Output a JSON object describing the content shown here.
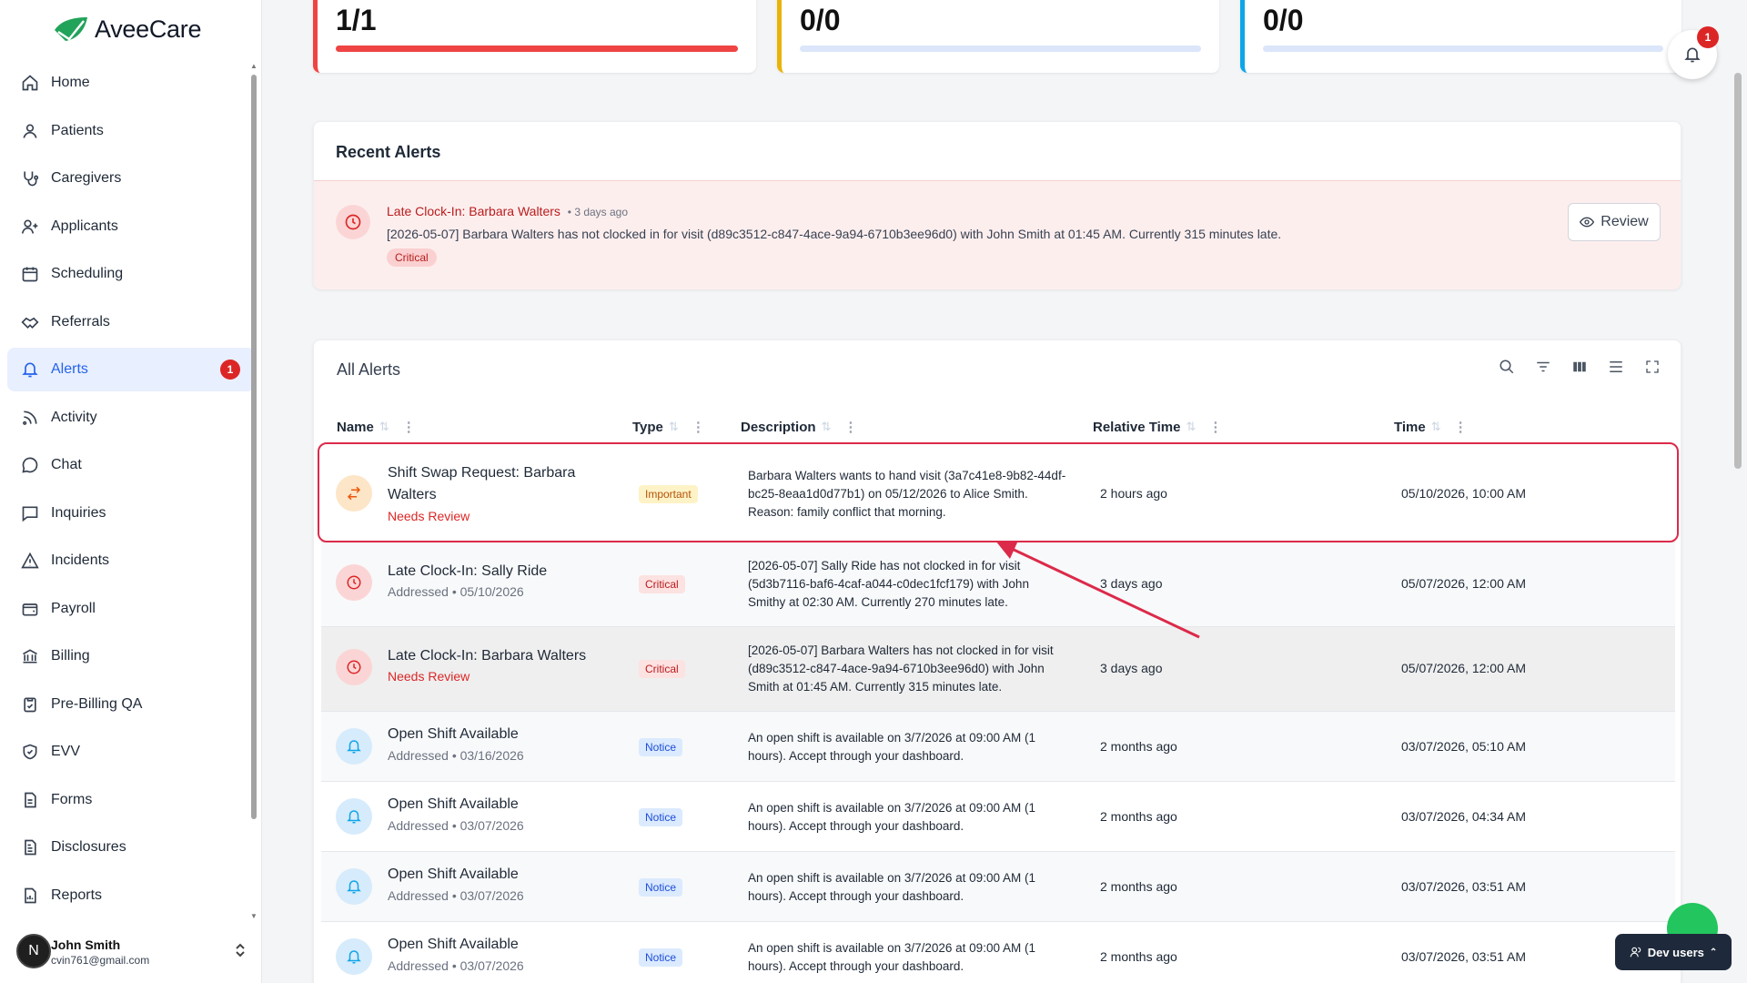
{
  "app": {
    "name": "AveeCare"
  },
  "sidebar": {
    "items": [
      {
        "label": "Home",
        "icon": "home-icon"
      },
      {
        "label": "Patients",
        "icon": "user-icon"
      },
      {
        "label": "Caregivers",
        "icon": "stethoscope-icon"
      },
      {
        "label": "Applicants",
        "icon": "user-plus-icon"
      },
      {
        "label": "Scheduling",
        "icon": "calendar-icon"
      },
      {
        "label": "Referrals",
        "icon": "handshake-icon"
      },
      {
        "label": "Alerts",
        "icon": "bell-icon",
        "active": true,
        "badge": "1"
      },
      {
        "label": "Activity",
        "icon": "rss-icon"
      },
      {
        "label": "Chat",
        "icon": "chat-icon"
      },
      {
        "label": "Inquiries",
        "icon": "message-square-icon"
      },
      {
        "label": "Incidents",
        "icon": "warning-icon"
      },
      {
        "label": "Payroll",
        "icon": "wallet-icon"
      },
      {
        "label": "Billing",
        "icon": "bank-icon"
      },
      {
        "label": "Pre-Billing QA",
        "icon": "clipboard-check-icon"
      },
      {
        "label": "EVV",
        "icon": "shield-check-icon"
      },
      {
        "label": "Forms",
        "icon": "file-icon"
      },
      {
        "label": "Disclosures",
        "icon": "file-text-icon"
      },
      {
        "label": "Reports",
        "icon": "report-icon"
      }
    ],
    "user": {
      "initial": "N",
      "name": "John Smith",
      "email": "cvin761@gmail.com"
    }
  },
  "stats": [
    {
      "value": "1/1",
      "color": "#ef4444",
      "progress": 1.0
    },
    {
      "value": "0/0",
      "color": "#eab308",
      "progress": 0
    },
    {
      "value": "0/0",
      "color": "#0ea5e9",
      "progress": 0
    }
  ],
  "notifications": {
    "badge": "1"
  },
  "recent_alerts": {
    "title": "Recent Alerts",
    "alert": {
      "title": "Late Clock-In: Barbara Walters",
      "meta": "• 3 days ago",
      "description": "[2026-05-07] Barbara Walters has not clocked in for visit (d89c3512-c847-4ace-9a94-6710b3ee96d0) with John Smith at 01:45 AM. Currently 315 minutes late.",
      "badge": "Critical"
    },
    "review_label": "Review"
  },
  "all_alerts": {
    "title": "All Alerts",
    "columns": [
      "Name",
      "Type",
      "Description",
      "Relative Time",
      "Time"
    ],
    "rows": [
      {
        "name": "Shift Swap Request: Barbara Walters",
        "sub": "Needs Review",
        "type": "Important",
        "description": "Barbara Walters wants to hand visit (3a7c41e8-9b82-44df-bc25-8eaa1d0d77b1) on 05/12/2026 to Alice Smith. Reason: family conflict that morning.",
        "relative": "2 hours ago",
        "time": "05/10/2026, 10:00 AM"
      },
      {
        "name": "Late Clock-In: Sally Ride",
        "sub": "Addressed • 05/10/2026",
        "type": "Critical",
        "description": "[2026-05-07] Sally Ride has not clocked in for visit (5d3b7116-baf6-4caf-a044-c0dec1fcf179) with John Smithy at 02:30 AM. Currently 270 minutes late.",
        "relative": "3 days ago",
        "time": "05/07/2026, 12:00 AM"
      },
      {
        "name": "Late Clock-In: Barbara Walters",
        "sub": "Needs Review",
        "type": "Critical",
        "description": "[2026-05-07] Barbara Walters has not clocked in for visit (d89c3512-c847-4ace-9a94-6710b3ee96d0) with John Smith at 01:45 AM. Currently 315 minutes late.",
        "relative": "3 days ago",
        "time": "05/07/2026, 12:00 AM"
      },
      {
        "name": "Open Shift Available",
        "sub": "Addressed • 03/16/2026",
        "type": "Notice",
        "description": "An open shift is available on 3/7/2026 at 09:00 AM (1 hours). Accept through your dashboard.",
        "relative": "2 months ago",
        "time": "03/07/2026, 05:10 AM"
      },
      {
        "name": "Open Shift Available",
        "sub": "Addressed • 03/07/2026",
        "type": "Notice",
        "description": "An open shift is available on 3/7/2026 at 09:00 AM (1 hours). Accept through your dashboard.",
        "relative": "2 months ago",
        "time": "03/07/2026, 04:34 AM"
      },
      {
        "name": "Open Shift Available",
        "sub": "Addressed • 03/07/2026",
        "type": "Notice",
        "description": "An open shift is available on 3/7/2026 at 09:00 AM (1 hours). Accept through your dashboard.",
        "relative": "2 months ago",
        "time": "03/07/2026, 03:51 AM"
      },
      {
        "name": "Open Shift Available",
        "sub": "Addressed • 03/07/2026",
        "type": "Notice",
        "description": "An open shift is available on 3/7/2026 at 09:00 AM (1 hours). Accept through your dashboard.",
        "relative": "2 months ago",
        "time": "03/07/2026, 03:51 AM"
      }
    ]
  },
  "dev_users": {
    "label": "Dev users"
  },
  "colors": {
    "accent": "#2563eb",
    "critical": "#dc2626",
    "highlight": "#dc2a4a"
  }
}
